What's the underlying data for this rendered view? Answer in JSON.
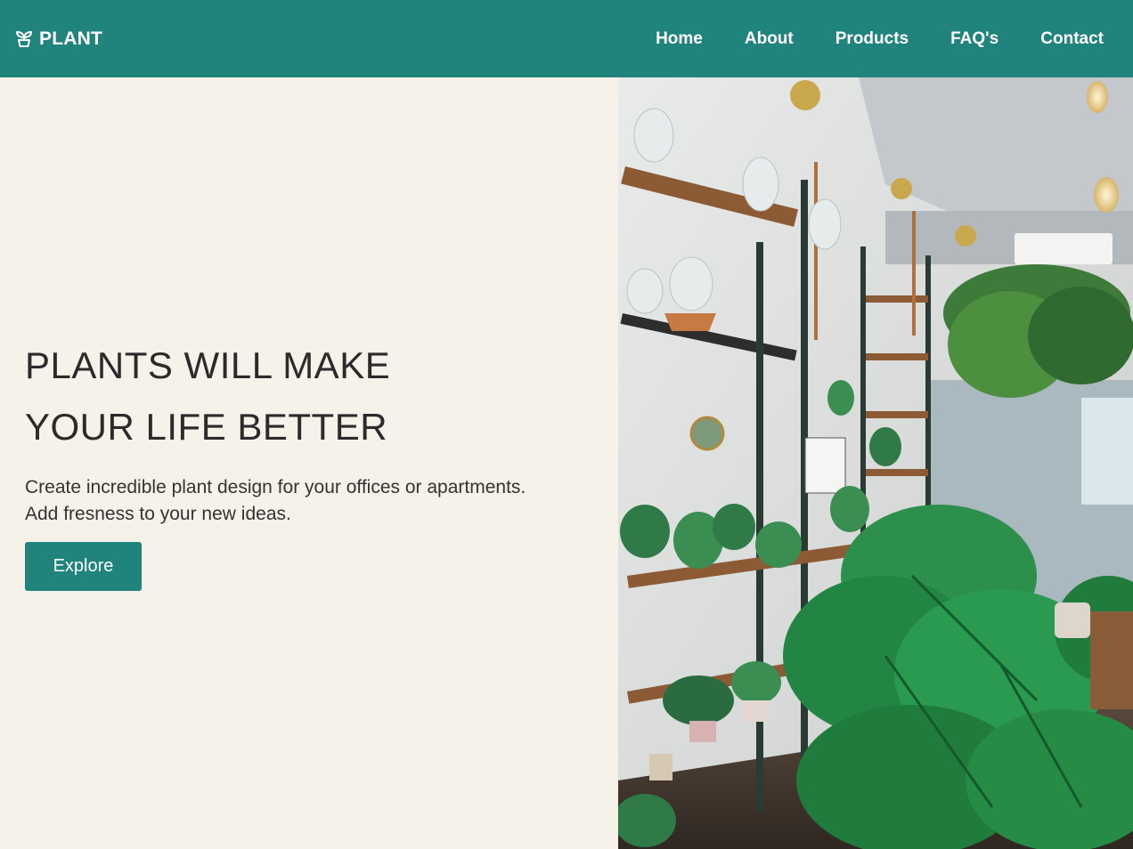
{
  "brand": {
    "name": "PLANT",
    "icon": "plant-pot-icon"
  },
  "nav": {
    "items": [
      {
        "label": "Home"
      },
      {
        "label": "About"
      },
      {
        "label": "Products"
      },
      {
        "label": "FAQ's"
      },
      {
        "label": "Contact"
      }
    ]
  },
  "hero": {
    "title_line1": "PLANTS WILL MAKE",
    "title_line2": "YOUR LIFE BETTER",
    "text_line1": "Create incredible plant design for your offices or apartments.",
    "text_line2": "Add fresness to your new ideas.",
    "button_label": "Explore"
  },
  "colors": {
    "primary": "#20837c",
    "background": "#f6f1e9",
    "text": "#2b2b2b"
  }
}
